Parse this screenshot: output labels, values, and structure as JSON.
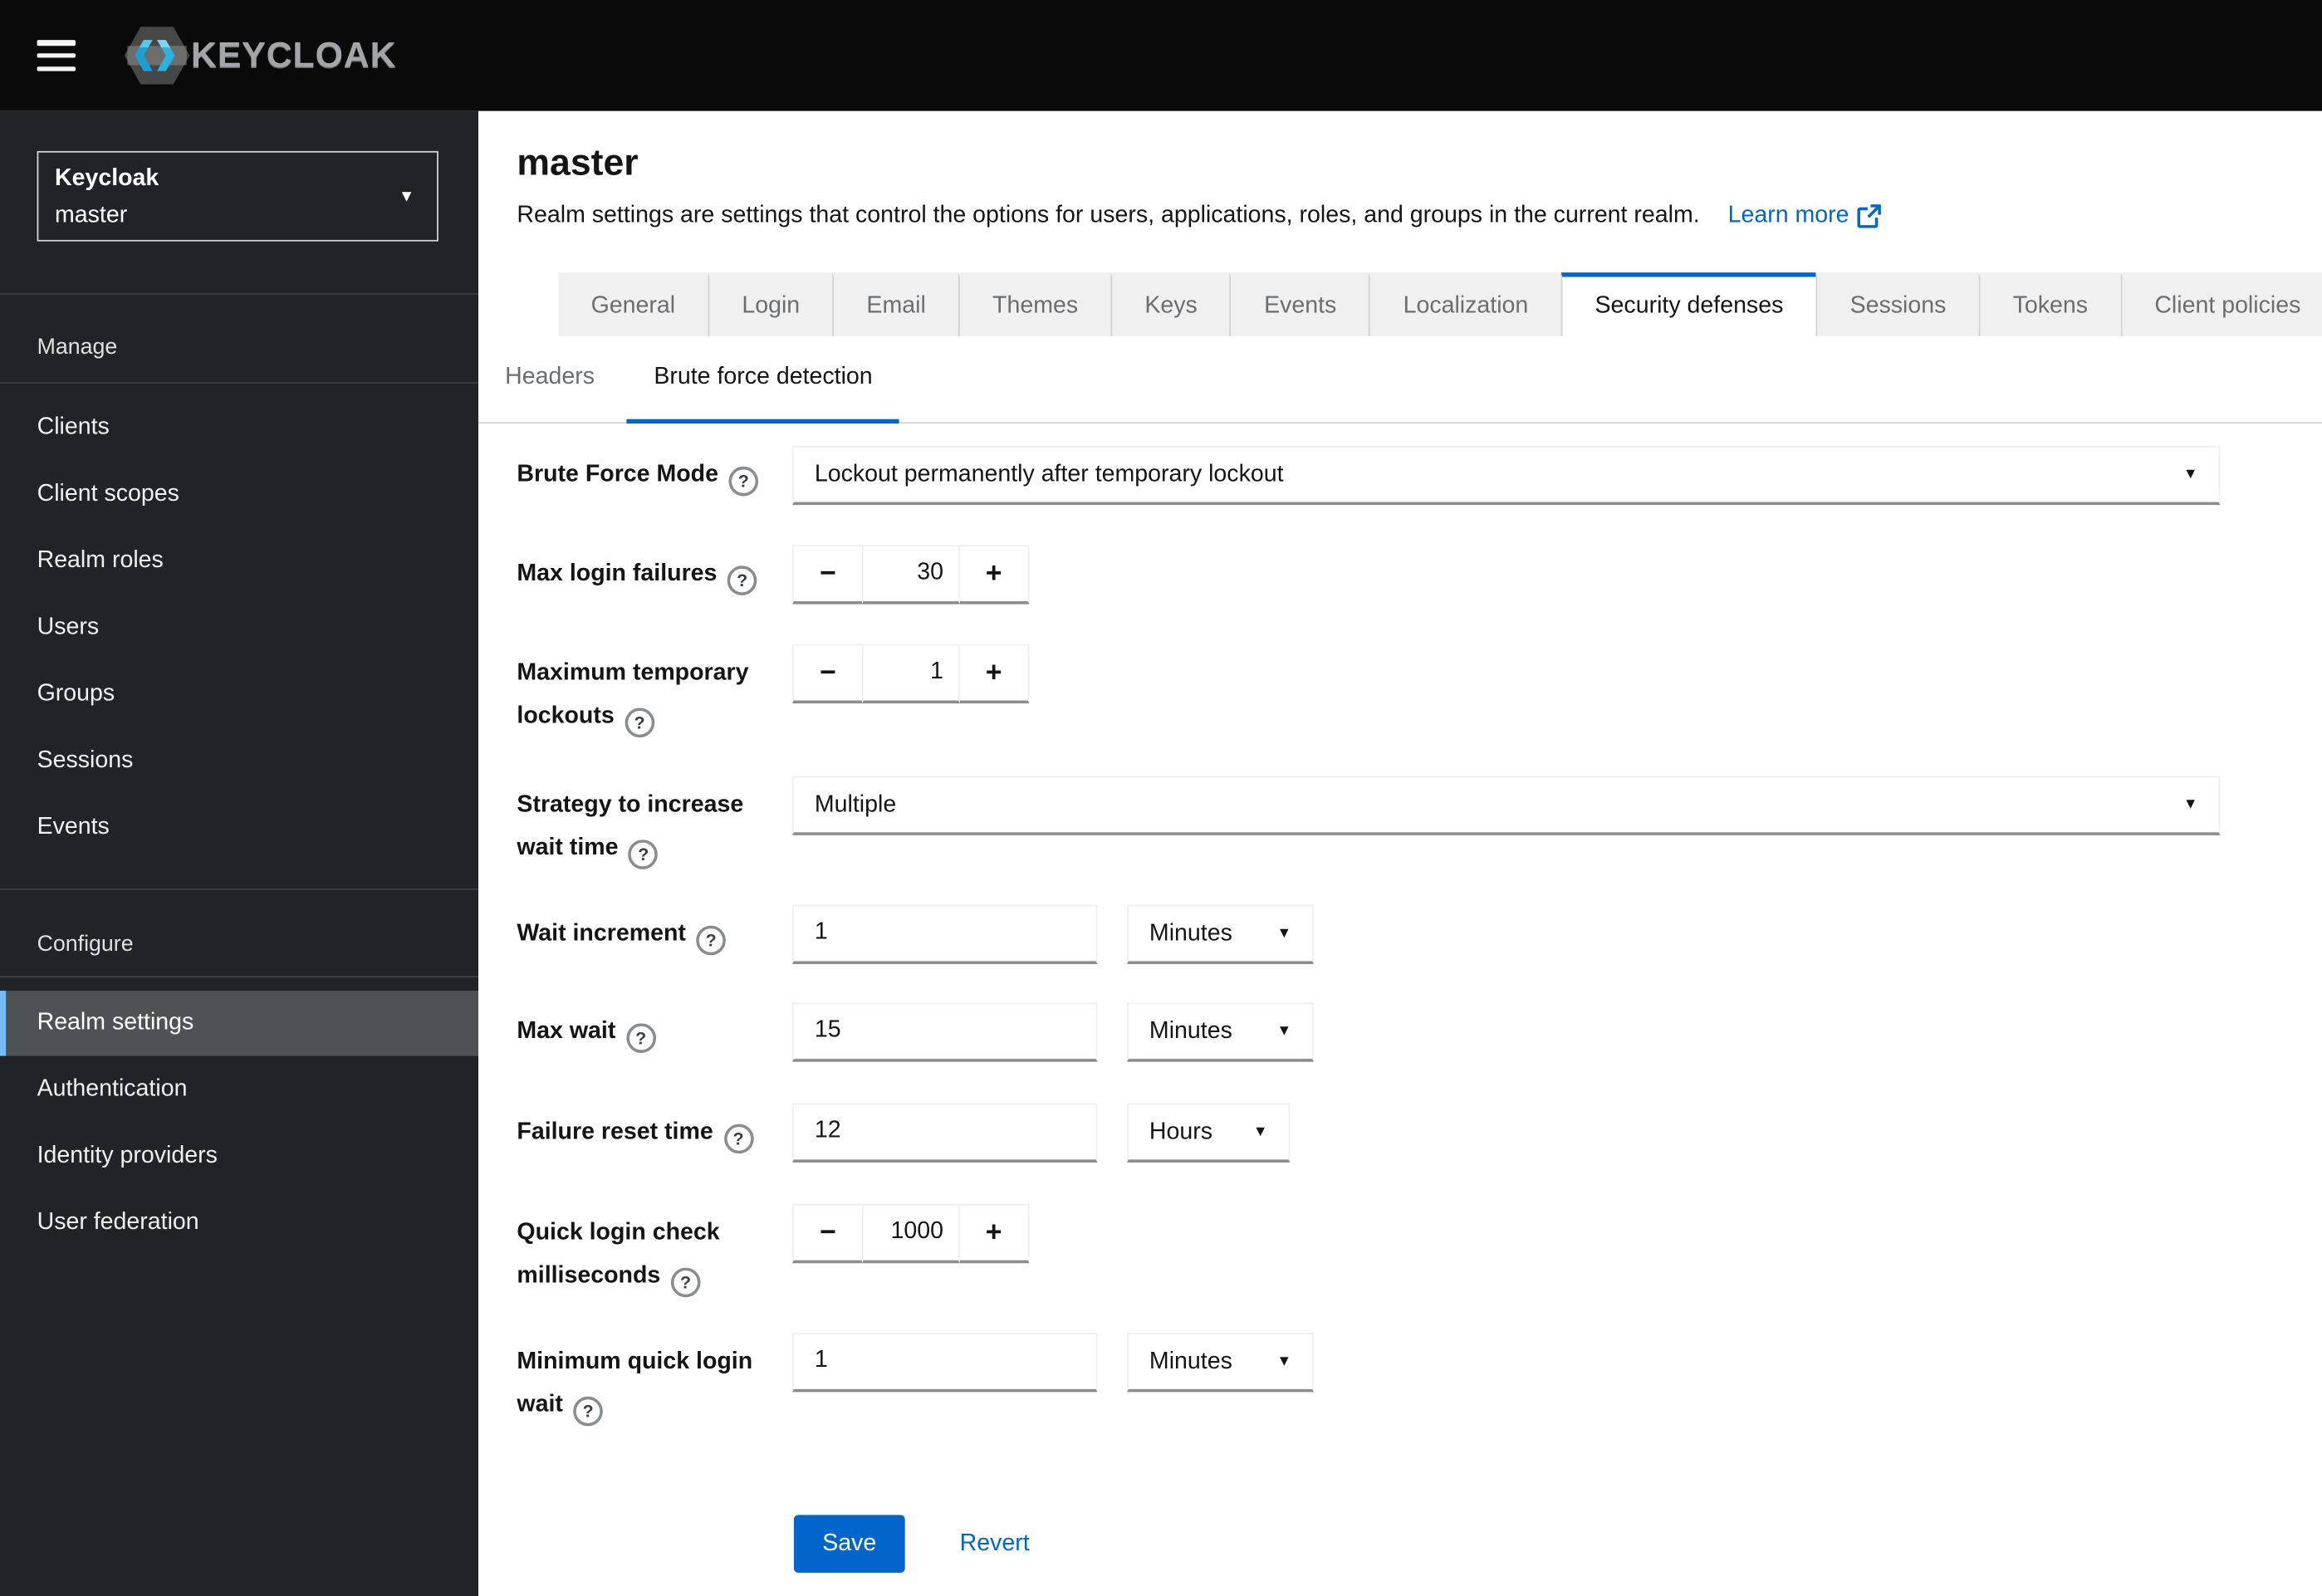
{
  "masthead": {
    "brand": "KEYCLOAK"
  },
  "sidebar": {
    "realm_selector": {
      "realm": "Keycloak",
      "current": "master"
    },
    "sections": [
      {
        "title": "Manage",
        "items": [
          "Clients",
          "Client scopes",
          "Realm roles",
          "Users",
          "Groups",
          "Sessions",
          "Events"
        ]
      },
      {
        "title": "Configure",
        "items": [
          "Realm settings",
          "Authentication",
          "Identity providers",
          "User federation"
        ],
        "selected": "Realm settings"
      }
    ]
  },
  "page": {
    "title": "master",
    "description": "Realm settings are settings that control the options for users, applications, roles, and groups in the current realm.",
    "learn_more": "Learn more"
  },
  "tabs": {
    "items": [
      "General",
      "Login",
      "Email",
      "Themes",
      "Keys",
      "Events",
      "Localization",
      "Security defenses",
      "Sessions",
      "Tokens",
      "Client policies"
    ],
    "active": "Security defenses"
  },
  "subtabs": {
    "items": [
      "Headers",
      "Brute force detection"
    ],
    "active": "Brute force detection"
  },
  "form": {
    "rows": [
      {
        "label": "Brute Force Mode",
        "type": "select",
        "value": "Lockout permanently after temporary lockout"
      },
      {
        "label": "Max login failures",
        "type": "stepper",
        "value": "30"
      },
      {
        "label": "Maximum temporary lockouts",
        "type": "stepper",
        "value": "1"
      },
      {
        "label": "Strategy to increase wait time",
        "type": "select",
        "value": "Multiple"
      },
      {
        "label": "Wait increment",
        "type": "input-unit",
        "value": "1",
        "unit": "Minutes"
      },
      {
        "label": "Max wait",
        "type": "input-unit",
        "value": "15",
        "unit": "Minutes"
      },
      {
        "label": "Failure reset time",
        "type": "input-unit",
        "value": "12",
        "unit": "Hours"
      },
      {
        "label": "Quick login check milliseconds",
        "type": "stepper",
        "value": "1000"
      },
      {
        "label": "Minimum quick login wait",
        "type": "input-unit",
        "value": "1",
        "unit": "Minutes"
      }
    ],
    "stepper": {
      "decrement": "−",
      "increment": "+"
    },
    "save_label": "Save",
    "revert_label": "Revert"
  },
  "icons": {
    "help": "?",
    "caret_down": "▼"
  },
  "colors": {
    "accent": "#0066cc",
    "masthead_bg": "#0a0a0a",
    "sidebar_bg": "#212427",
    "nav_selected_bg": "#4f5255",
    "nav_selected_border": "#73bcf7",
    "tab_inactive_bg": "#f0f0f0",
    "muted_text": "#6a6e73",
    "input_border_bottom": "#8a8d90"
  }
}
